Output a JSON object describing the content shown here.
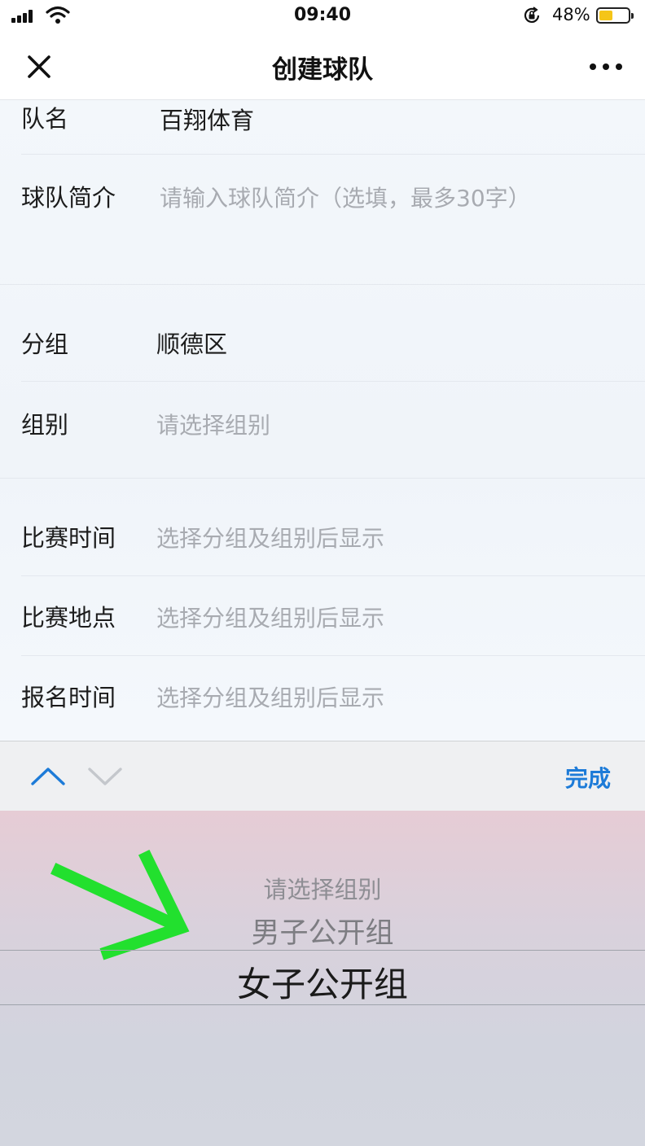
{
  "status_bar": {
    "time": "09:40",
    "battery_percent": "48%",
    "battery_level": 0.48,
    "icons": [
      "signal-icon",
      "wifi-icon",
      "rotation-lock-icon",
      "battery-icon"
    ]
  },
  "nav": {
    "title": "创建球队",
    "icons": [
      "close-icon",
      "more-icon"
    ]
  },
  "form": {
    "team_name": {
      "label": "队名",
      "value": "百翔体育"
    },
    "intro": {
      "label": "球队简介",
      "placeholder": "请输入球队简介（选填，最多30字）"
    },
    "group": {
      "label": "分组",
      "value": "顺德区"
    },
    "category": {
      "label": "组别",
      "placeholder": "请选择组别"
    },
    "match_time": {
      "label": "比赛时间",
      "placeholder": "选择分组及组别后显示"
    },
    "match_place": {
      "label": "比赛地点",
      "placeholder": "选择分组及组别后显示"
    },
    "signup_time": {
      "label": "报名时间",
      "placeholder": "选择分组及组别后显示"
    }
  },
  "toolbar": {
    "done_label": "完成",
    "icons": [
      "chevron-up-icon",
      "chevron-down-icon"
    ]
  },
  "picker": {
    "options": [
      "请选择组别",
      "男子公开组",
      "女子公开组"
    ],
    "selected_index": 2
  },
  "annotation": {
    "arrow_color": "#22e02e"
  },
  "colors": {
    "accent": "#1d7bd8",
    "placeholder": "#a8abb1"
  }
}
